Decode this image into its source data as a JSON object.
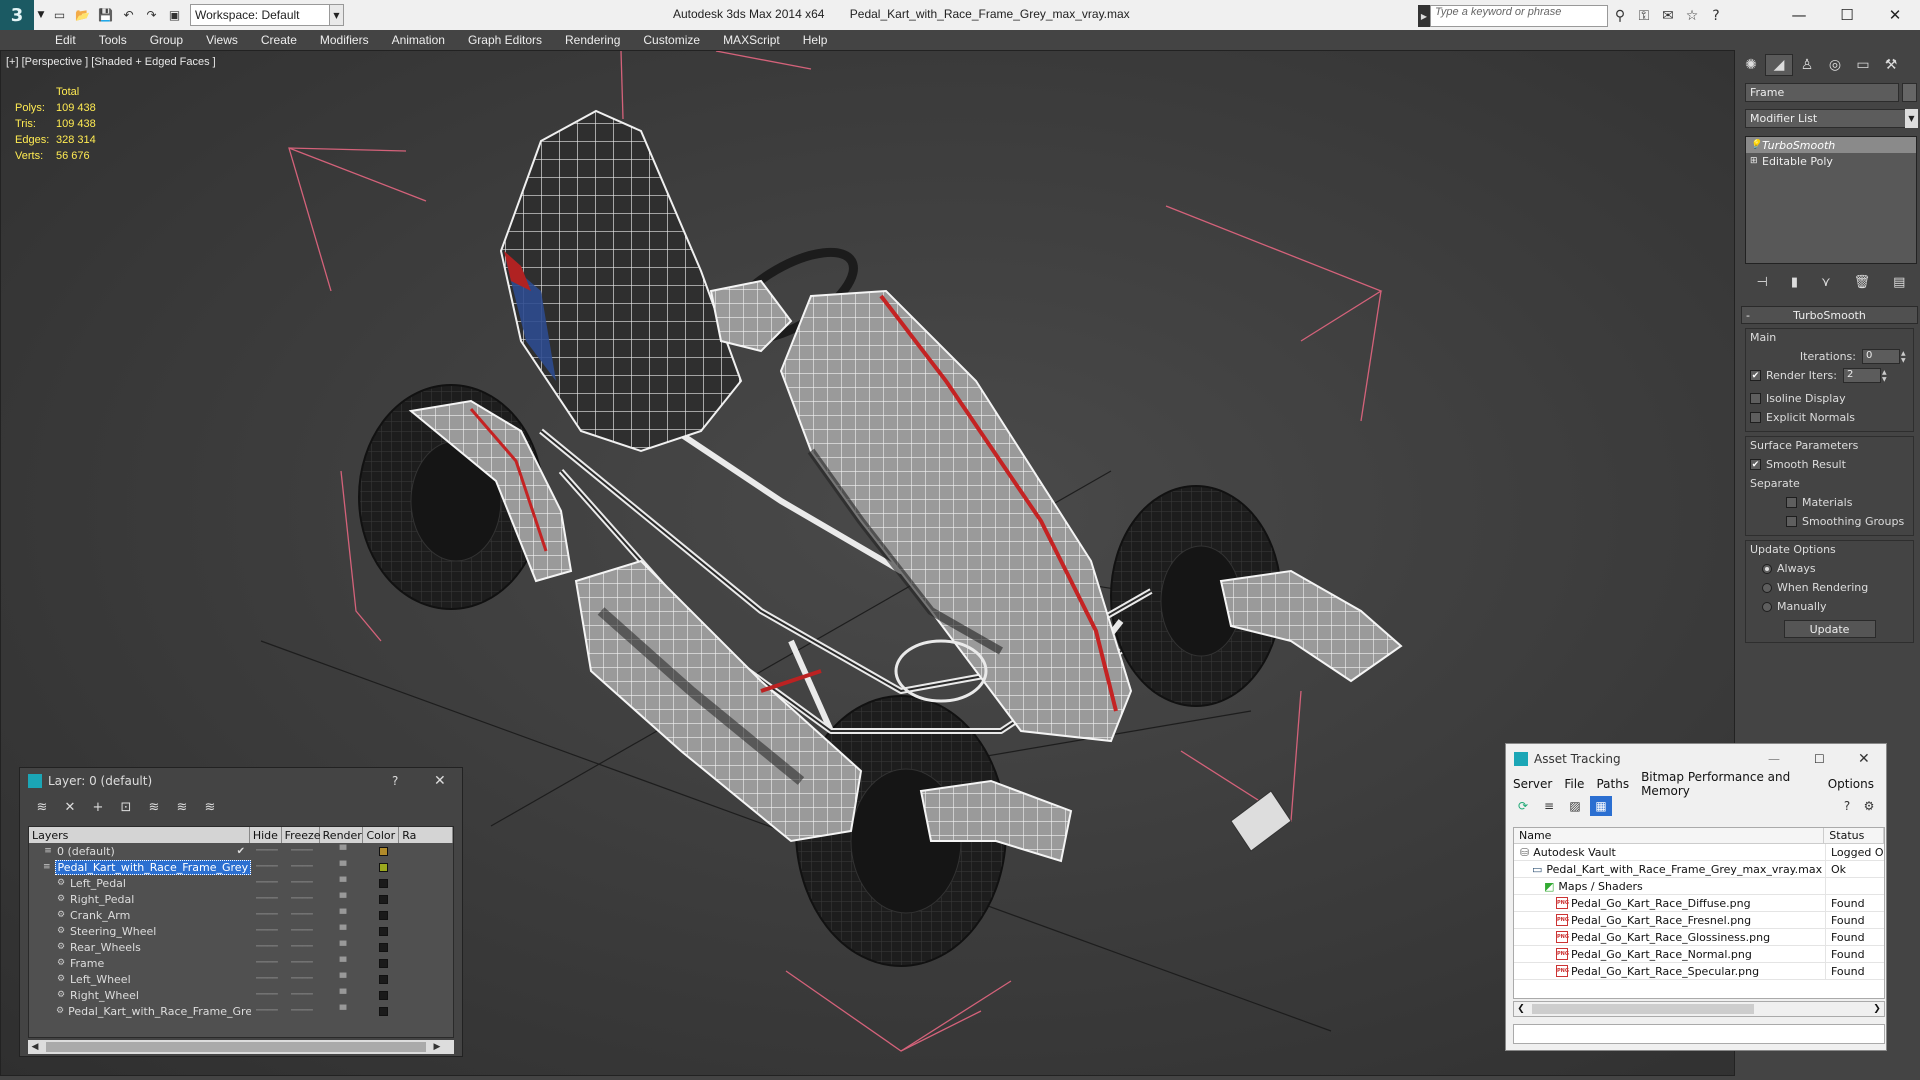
{
  "titlebar": {
    "workspace": "Workspace: Default",
    "app_name": "Autodesk 3ds Max  2014 x64",
    "file_name": "Pedal_Kart_with_Race_Frame_Grey_max_vray.max",
    "search_placeholder": "Type a keyword or phrase"
  },
  "menu": [
    "Edit",
    "Tools",
    "Group",
    "Views",
    "Create",
    "Modifiers",
    "Animation",
    "Graph Editors",
    "Rendering",
    "Customize",
    "MAXScript",
    "Help"
  ],
  "viewport": {
    "label": "[+] [Perspective ] [Shaded + Edged Faces ]",
    "stats_header": "Total",
    "stats": [
      {
        "label": "Polys:",
        "value": "109 438"
      },
      {
        "label": "Tris:",
        "value": "109 438"
      },
      {
        "label": "Edges:",
        "value": "328 314"
      },
      {
        "label": "Verts:",
        "value": "56 676"
      }
    ]
  },
  "command_panel": {
    "object_name": "Frame",
    "modifier_list": "Modifier List",
    "stack": [
      "TurboSmooth",
      "Editable Poly"
    ],
    "rollout_title": "TurboSmooth",
    "main_group": "Main",
    "iterations_label": "Iterations:",
    "iterations_value": "0",
    "render_iters_label": "Render Iters:",
    "render_iters_value": "2",
    "isoline_display": "Isoline Display",
    "explicit_normals": "Explicit Normals",
    "surface_group": "Surface Parameters",
    "smooth_result": "Smooth Result",
    "separate_label": "Separate",
    "materials": "Materials",
    "smoothing_groups": "Smoothing Groups",
    "update_group": "Update Options",
    "always": "Always",
    "when_rendering": "When Rendering",
    "manually": "Manually",
    "update_button": "Update"
  },
  "layer_dialog": {
    "title": "Layer: 0 (default)",
    "help": "?",
    "columns": [
      "Layers",
      "Hide",
      "Freeze",
      "Render",
      "Color",
      "Ra"
    ],
    "rows": [
      {
        "name": "0 (default)",
        "indent": 1,
        "color": "#b08a2a"
      },
      {
        "name": "Pedal_Kart_with_Race_Frame_Grey",
        "indent": 1,
        "color": "#9aa81e"
      },
      {
        "name": "Left_Pedal",
        "indent": 2,
        "color": "#1a1a1a"
      },
      {
        "name": "Right_Pedal",
        "indent": 2,
        "color": "#1a1a1a"
      },
      {
        "name": "Crank_Arm",
        "indent": 2,
        "color": "#1a1a1a"
      },
      {
        "name": "Steering_Wheel",
        "indent": 2,
        "color": "#1a1a1a"
      },
      {
        "name": "Rear_Wheels",
        "indent": 2,
        "color": "#1a1a1a"
      },
      {
        "name": "Frame",
        "indent": 2,
        "color": "#1a1a1a"
      },
      {
        "name": "Left_Wheel",
        "indent": 2,
        "color": "#1a1a1a"
      },
      {
        "name": "Right_Wheel",
        "indent": 2,
        "color": "#1a1a1a"
      },
      {
        "name": "Pedal_Kart_with_Race_Frame_Grey",
        "indent": 2,
        "color": "#1a1a1a"
      }
    ]
  },
  "asset_dialog": {
    "title": "Asset Tracking",
    "menu": [
      "Server",
      "File",
      "Paths",
      "Bitmap Performance and Memory",
      "Options"
    ],
    "columns": [
      "Name",
      "Status"
    ],
    "rows": [
      {
        "name": "Autodesk Vault",
        "status": "Logged O",
        "indent": 1,
        "icon": "vault"
      },
      {
        "name": "Pedal_Kart_with_Race_Frame_Grey_max_vray.max",
        "status": "Ok",
        "indent": 2,
        "icon": "max"
      },
      {
        "name": "Maps / Shaders",
        "status": "",
        "indent": 3,
        "icon": "maps"
      },
      {
        "name": "Pedal_Go_Kart_Race_Diffuse.png",
        "status": "Found",
        "indent": 4,
        "icon": "png"
      },
      {
        "name": "Pedal_Go_Kart_Race_Fresnel.png",
        "status": "Found",
        "indent": 4,
        "icon": "png"
      },
      {
        "name": "Pedal_Go_Kart_Race_Glossiness.png",
        "status": "Found",
        "indent": 4,
        "icon": "png"
      },
      {
        "name": "Pedal_Go_Kart_Race_Normal.png",
        "status": "Found",
        "indent": 4,
        "icon": "png"
      },
      {
        "name": "Pedal_Go_Kart_Race_Specular.png",
        "status": "Found",
        "indent": 4,
        "icon": "png"
      }
    ]
  },
  "colors": {
    "selection": "#2b6fd1",
    "stats_text": "#ffeb52",
    "bbox_lines": "#d4627a",
    "kart_red": "#c42323"
  }
}
